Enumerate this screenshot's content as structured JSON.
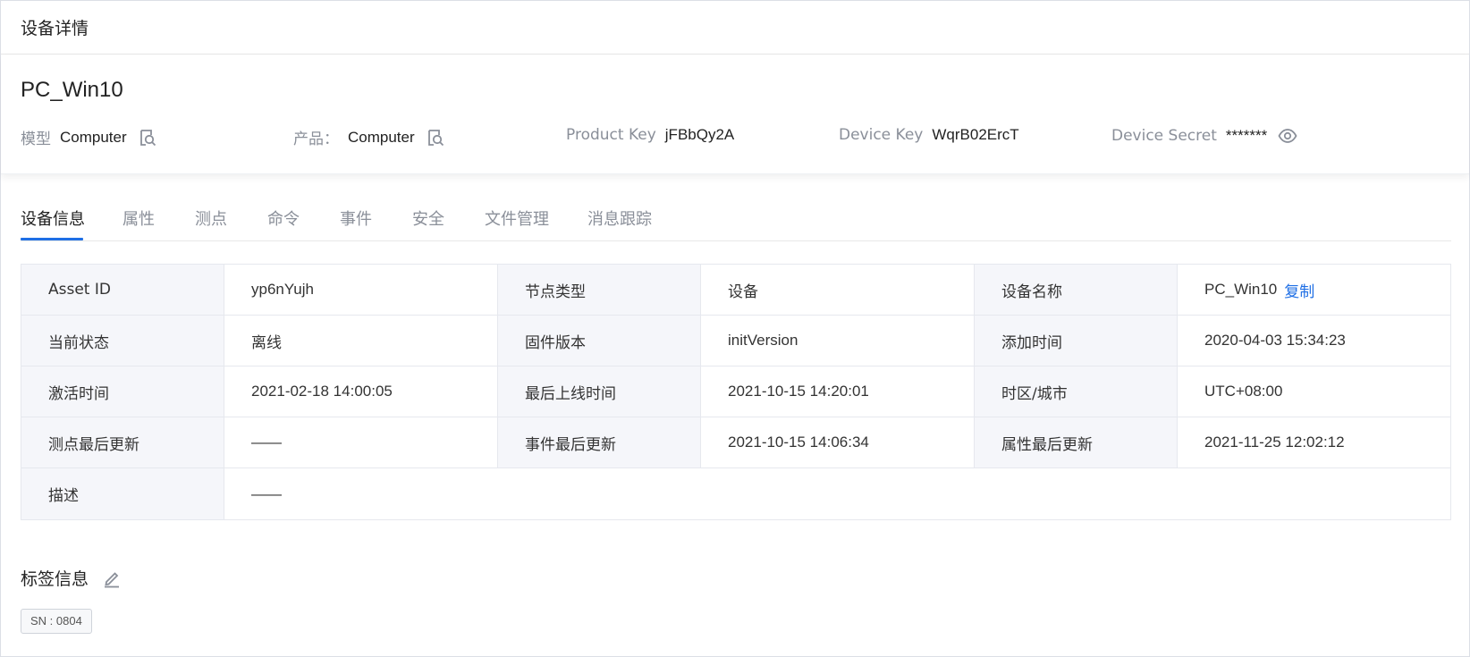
{
  "page_header": {
    "title": "设备详情"
  },
  "device": {
    "name": "PC_Win10",
    "meta": {
      "model": {
        "label": "模型",
        "value": "Computer",
        "icon": "search-doc-icon"
      },
      "product": {
        "label": "产品：",
        "value": "Computer",
        "icon": "search-doc-icon"
      },
      "product_key": {
        "label": "Product Key",
        "value": "jFBbQy2A"
      },
      "device_key": {
        "label": "Device Key",
        "value": "WqrB02ErcT"
      },
      "device_secret": {
        "label": "Device Secret",
        "value": "*******",
        "icon": "eye-icon"
      }
    }
  },
  "tabs": [
    {
      "label": "设备信息",
      "active": true
    },
    {
      "label": "属性"
    },
    {
      "label": "测点"
    },
    {
      "label": "命令"
    },
    {
      "label": "事件"
    },
    {
      "label": "安全"
    },
    {
      "label": "文件管理"
    },
    {
      "label": "消息跟踪"
    }
  ],
  "info": {
    "asset_id": {
      "label": "Asset ID",
      "value": "yp6nYujh"
    },
    "node_type": {
      "label": "节点类型",
      "value": "设备"
    },
    "device_name": {
      "label": "设备名称",
      "value": "PC_Win10",
      "action": "复制"
    },
    "status": {
      "label": "当前状态",
      "value": "离线"
    },
    "firmware": {
      "label": "固件版本",
      "value": "initVersion"
    },
    "added_time": {
      "label": "添加时间",
      "value": "2020-04-03 15:34:23"
    },
    "activated_time": {
      "label": "激活时间",
      "value": "2021-02-18 14:00:05"
    },
    "last_online": {
      "label": "最后上线时间",
      "value": "2021-10-15 14:20:01"
    },
    "timezone": {
      "label": "时区/城市",
      "value": "UTC+08:00"
    },
    "measure_update": {
      "label": "测点最后更新",
      "value": "——"
    },
    "event_update": {
      "label": "事件最后更新",
      "value": "2021-10-15 14:06:34"
    },
    "attr_update": {
      "label": "属性最后更新",
      "value": "2021-11-25 12:02:12"
    },
    "description": {
      "label": "描述",
      "value": "——"
    }
  },
  "tags": {
    "title": "标签信息",
    "items": [
      "SN : 0804"
    ]
  },
  "colors": {
    "accent": "#1f6fe5",
    "muted": "#8a8f99",
    "key_bg": "#f5f6fa"
  }
}
